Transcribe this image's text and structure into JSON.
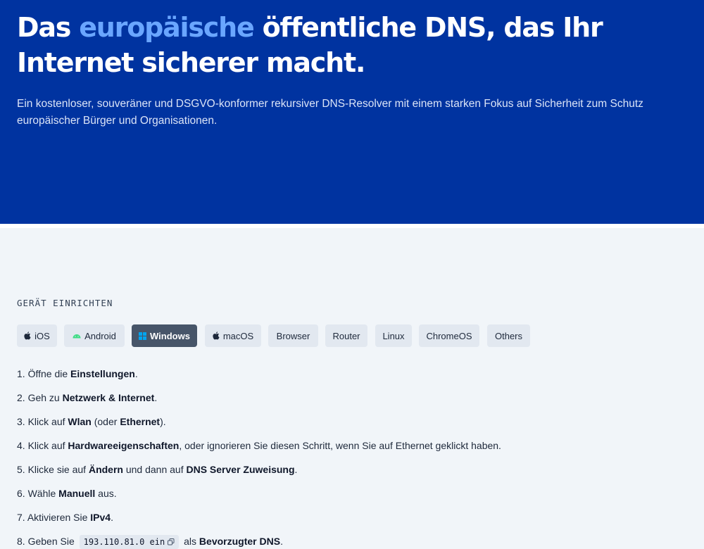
{
  "hero": {
    "title_before": "Das ",
    "title_accent": "europäische",
    "title_after": " öffentliche DNS, das Ihr Internet sicherer macht.",
    "subtitle": "Ein kostenloser, souveräner und DSGVO-konformer rekursiver DNS-Resolver mit einem starken Fokus auf Sicherheit zum Schutz europäischer Bürger und Organisationen."
  },
  "setup": {
    "label": "GERÄT EINRICHTEN",
    "tabs": [
      {
        "label": "iOS",
        "icon": "apple-icon"
      },
      {
        "label": "Android",
        "icon": "android-icon"
      },
      {
        "label": "Windows",
        "icon": "windows-icon",
        "active": true
      },
      {
        "label": "macOS",
        "icon": "apple-icon"
      },
      {
        "label": "Browser"
      },
      {
        "label": "Router"
      },
      {
        "label": "Linux"
      },
      {
        "label": "ChromeOS"
      },
      {
        "label": "Others"
      }
    ],
    "steps": [
      {
        "n": "1.",
        "a": "Öffne die ",
        "b": "Einstellungen",
        "c": "."
      },
      {
        "n": "2.",
        "a": "Geh zu ",
        "b": "Netzwerk & Internet",
        "c": "."
      },
      {
        "n": "3.",
        "a": "Klick auf ",
        "b": "Wlan",
        "c": " (oder ",
        "d": "Ethernet",
        "e": ")."
      },
      {
        "n": "4.",
        "a": "Klick auf ",
        "b": "Hardwareeigenschaften",
        "c": ", oder ignorieren Sie diesen Schritt, wenn Sie auf Ethernet geklickt haben."
      },
      {
        "n": "5.",
        "a": "Klicke sie auf ",
        "b": "Ändern",
        "c": " und dann auf ",
        "d": "DNS Server Zuweisung",
        "e": "."
      },
      {
        "n": "6.",
        "a": "Wähle ",
        "b": "Manuell",
        "c": " aus."
      },
      {
        "n": "7.",
        "a": "Aktivieren Sie ",
        "b": "IPv4",
        "c": "."
      },
      {
        "n": "8.",
        "a": "Geben Sie ",
        "code": "193.110.81.0 ein",
        "c": " als ",
        "d": "Bevorzugter DNS",
        "e": "."
      }
    ]
  },
  "colors": {
    "hero_bg": "#0033a0",
    "accent": "#6aa6ff",
    "active_tab": "#475569",
    "tab_bg": "#e2e8f0",
    "page_bg": "#f1f5f9"
  }
}
